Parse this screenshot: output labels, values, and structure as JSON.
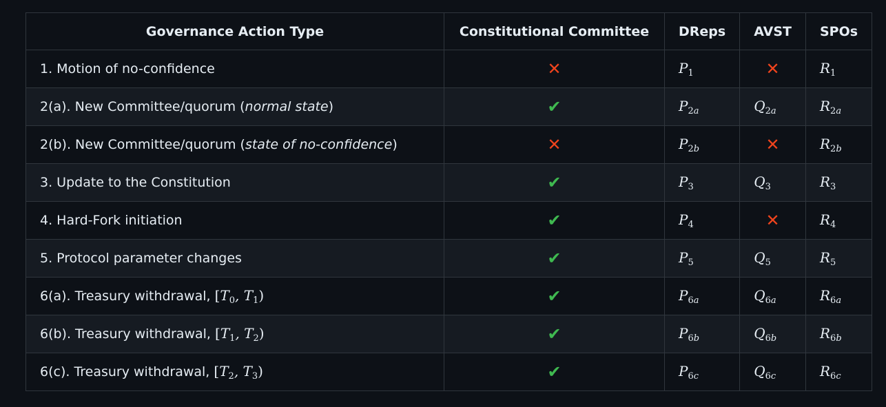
{
  "headers": [
    "Governance Action Type",
    "Constitutional Committee",
    "DReps",
    "AVST",
    "SPOs"
  ],
  "colors": {
    "background": "#0d1117",
    "row_alt": "#161b22",
    "border": "#30363d",
    "check": "#3fb950",
    "cross": "#f0441d"
  },
  "icons": {
    "yes": "check-icon",
    "no": "cross-icon"
  },
  "rows": [
    {
      "label": "1. Motion of no-confidence",
      "italic": "",
      "suffix": "",
      "interval": null,
      "cc": "no",
      "dreps": [
        "P",
        "1"
      ],
      "avst": "no",
      "spos": [
        "R",
        "1"
      ]
    },
    {
      "label": "2(a). New Committee/quorum (",
      "italic": "normal state",
      "suffix": ")",
      "interval": null,
      "cc": "yes",
      "dreps": [
        "P",
        "2a"
      ],
      "avst": [
        "Q",
        "2a"
      ],
      "spos": [
        "R",
        "2a"
      ]
    },
    {
      "label": "2(b). New Committee/quorum (",
      "italic": "state of no-confidence",
      "suffix": ")",
      "interval": null,
      "cc": "no",
      "dreps": [
        "P",
        "2b"
      ],
      "avst": "no",
      "spos": [
        "R",
        "2b"
      ]
    },
    {
      "label": "3. Update to the Constitution",
      "italic": "",
      "suffix": "",
      "interval": null,
      "cc": "yes",
      "dreps": [
        "P",
        "3"
      ],
      "avst": [
        "Q",
        "3"
      ],
      "spos": [
        "R",
        "3"
      ]
    },
    {
      "label": "4. Hard-Fork initiation",
      "italic": "",
      "suffix": "",
      "interval": null,
      "cc": "yes",
      "dreps": [
        "P",
        "4"
      ],
      "avst": "no",
      "spos": [
        "R",
        "4"
      ]
    },
    {
      "label": "5. Protocol parameter changes",
      "italic": "",
      "suffix": "",
      "interval": null,
      "cc": "yes",
      "dreps": [
        "P",
        "5"
      ],
      "avst": [
        "Q",
        "5"
      ],
      "spos": [
        "R",
        "5"
      ]
    },
    {
      "label": "6(a). Treasury withdrawal, ",
      "italic": "",
      "suffix": "",
      "interval": [
        "0",
        "1"
      ],
      "cc": "yes",
      "dreps": [
        "P",
        "6a"
      ],
      "avst": [
        "Q",
        "6a"
      ],
      "spos": [
        "R",
        "6a"
      ]
    },
    {
      "label": "6(b). Treasury withdrawal, ",
      "italic": "",
      "suffix": "",
      "interval": [
        "1",
        "2"
      ],
      "cc": "yes",
      "dreps": [
        "P",
        "6b"
      ],
      "avst": [
        "Q",
        "6b"
      ],
      "spos": [
        "R",
        "6b"
      ]
    },
    {
      "label": "6(c). Treasury withdrawal, ",
      "italic": "",
      "suffix": "",
      "interval": [
        "2",
        "3"
      ],
      "cc": "yes",
      "dreps": [
        "P",
        "6c"
      ],
      "avst": [
        "Q",
        "6c"
      ],
      "spos": [
        "R",
        "6c"
      ]
    }
  ]
}
